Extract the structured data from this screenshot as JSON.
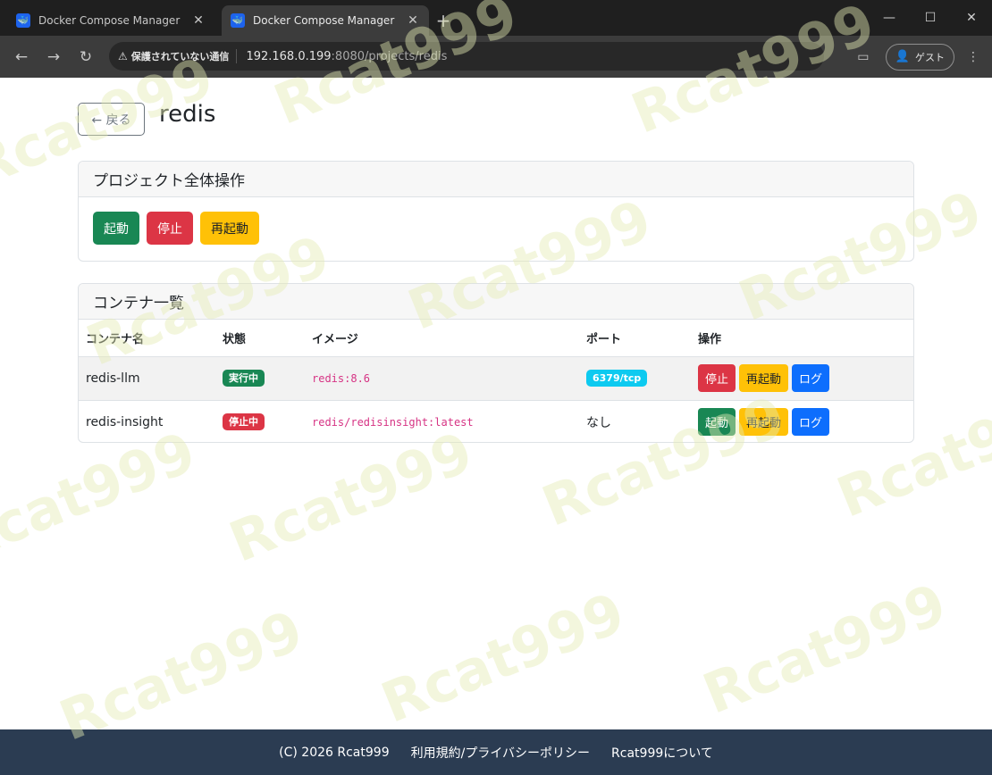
{
  "browser": {
    "tabs": [
      {
        "title": "Docker Compose Manager",
        "active": false
      },
      {
        "title": "Docker Compose Manager",
        "active": true
      }
    ],
    "security_label": "保護されていない通信",
    "url_host": "192.168.0.199",
    "url_rest": ":8080/projects/redis",
    "guest_label": "ゲスト"
  },
  "page": {
    "back_label": "← 戻る",
    "title": "redis"
  },
  "project_ops": {
    "header": "プロジェクト全体操作",
    "start_label": "起動",
    "stop_label": "停止",
    "restart_label": "再起動"
  },
  "containers": {
    "header": "コンテナ一覧",
    "columns": [
      "コンテナ名",
      "状態",
      "イメージ",
      "ポート",
      "操作"
    ],
    "rows": [
      {
        "name": "redis-llm",
        "status": "実行中",
        "image": "redis:8.6",
        "port": "6379/tcp",
        "ops": [
          "停止",
          "再起動",
          "ログ"
        ]
      },
      {
        "name": "redis-insight",
        "status": "停止中",
        "image": "redis/redisinsight:latest",
        "port": "なし",
        "ops": [
          "起動",
          "再起動",
          "ログ"
        ]
      }
    ]
  },
  "footer": {
    "copyright": "(C) 2026 Rcat999",
    "terms": "利用規約/プライバシーポリシー",
    "about": "Rcat999について"
  },
  "watermark": "Rcat999",
  "colors": {
    "success": "#198754",
    "danger": "#dc3545",
    "warning": "#ffc107",
    "primary": "#0d6efd",
    "info": "#0dcaf0",
    "footer_bg": "#2b3c52"
  }
}
